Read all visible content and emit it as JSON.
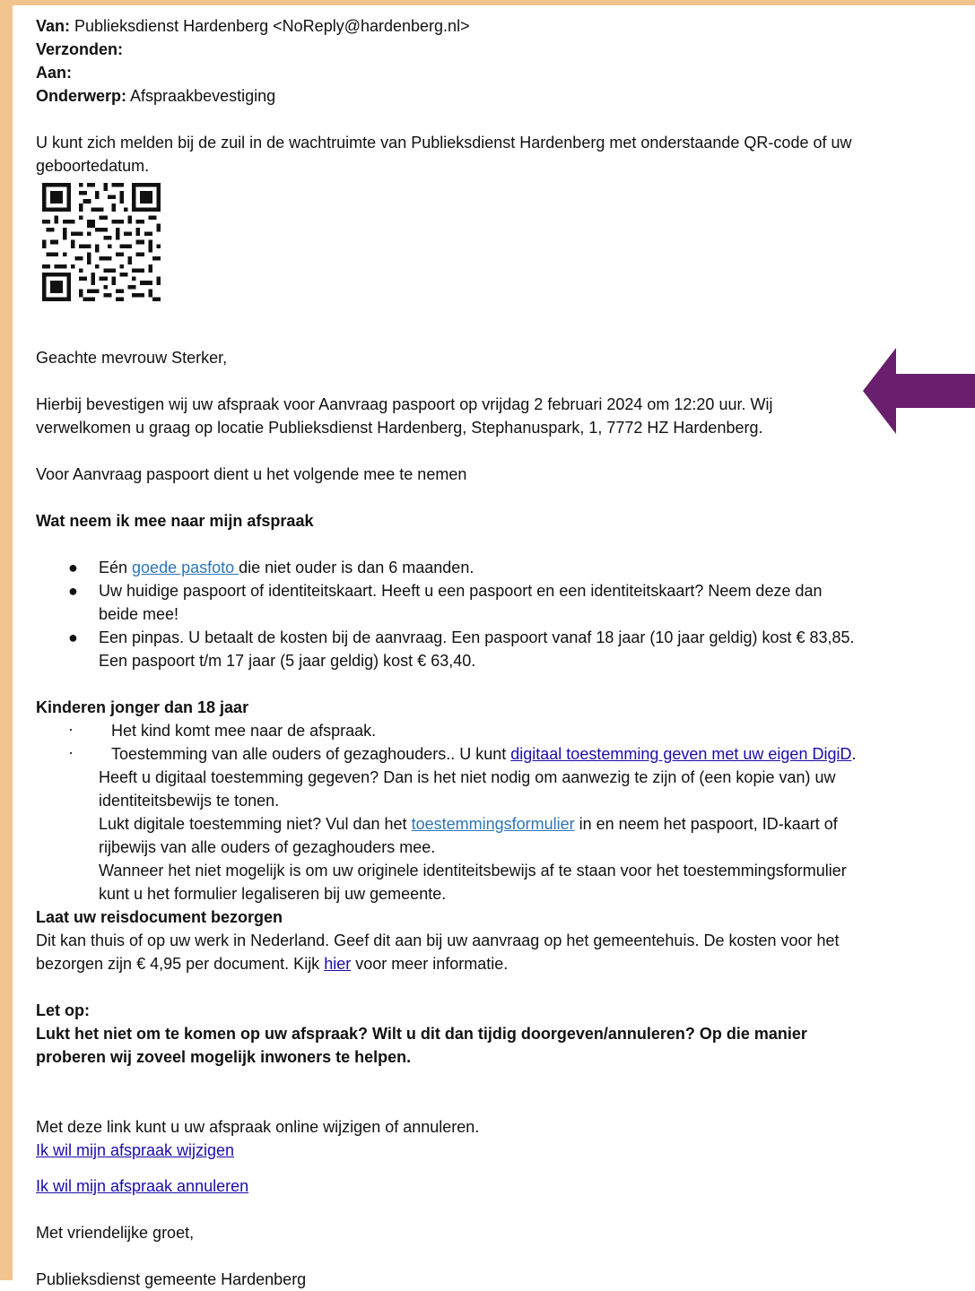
{
  "header": {
    "van_label": "Van:",
    "van_value": "Publieksdienst Hardenberg <NoReply@hardenberg.nl>",
    "verzonden_label": "Verzonden:",
    "aan_label": "Aan:",
    "onderwerp_label": "Onderwerp:",
    "onderwerp_value": "Afspraakbevestiging"
  },
  "intro": "U kunt zich melden bij de zuil in de wachtruimte van Publieksdienst Hardenberg met onderstaande QR-code of uw geboortedatum.",
  "greeting": "Geachte mevrouw Sterker,",
  "confirmation": "Hierbij bevestigen wij uw afspraak voor Aanvraag paspoort op vrijdag 2 februari 2024 om 12:20 uur. Wij verwelkomen u graag op locatie Publieksdienst Hardenberg, Stephanuspark, 1, 7772 HZ Hardenberg.",
  "bring_intro": "Voor Aanvraag paspoort dient u het volgende mee te nemen",
  "bring_heading": "Wat neem ik mee naar mijn afspraak",
  "bring_items": {
    "item1_pre": "Eén ",
    "item1_link": "goede pasfoto ",
    "item1_post": "die niet ouder is dan 6 maanden.",
    "item2": "Uw huidige paspoort of identiteitskaart. Heeft u een paspoort en een identiteitskaart? Neem deze dan beide mee!",
    "item3": "Een pinpas. U betaalt de kosten bij de aanvraag. Een paspoort vanaf 18 jaar (10 jaar geldig) kost € 83,85. Een paspoort t/m 17 jaar (5 jaar geldig) kost € 63,40."
  },
  "kids": {
    "heading": "Kinderen jonger dan 18 jaar",
    "item1": "Het kind komt mee naar de afspraak.",
    "item2_pre": "Toestemming van alle ouders of gezaghouders.. U kunt ",
    "item2_link": "digitaal toestemming geven met uw eigen DigiD",
    "item2_post": ". Heeft u digitaal toestemming gegeven? Dan is het niet nodig om aanwezig te zijn of (een kopie van) uw identiteitsbewijs te tonen.",
    "item2_line2_pre": "Lukt digitale toestemming niet? Vul dan het ",
    "item2_line2_link": "toestemmingsformulier",
    "item2_line2_post": " in en neem het paspoort, ID-kaart of rijbewijs van alle ouders of gezaghouders mee.",
    "item2_line3": "Wanneer het niet mogelijk is om uw originele identiteitsbewijs af te staan voor het toestemmingsformulier kunt u het formulier legaliseren bij uw gemeente."
  },
  "delivery": {
    "heading": "Laat uw reisdocument bezorgen",
    "text_pre": "Dit kan thuis of op uw werk in Nederland. Geef dit aan bij uw aanvraag op het gemeentehuis. De kosten voor het bezorgen zijn € 4,95 per document. Kijk ",
    "text_link": "hier",
    "text_post": " voor meer informatie."
  },
  "notice": {
    "heading": "Let op:",
    "text": "Lukt het niet om te komen op uw afspraak? Wilt u dit dan tijdig doorgeven/annuleren? Op die manier proberen wij zoveel mogelijk inwoners te helpen."
  },
  "links": {
    "intro": "Met deze link kunt u uw afspraak online wijzigen of annuleren.",
    "change": "Ik wil mijn afspraak wijzigen",
    "cancel": "Ik wil mijn afspraak annuleren"
  },
  "closing": "Met vriendelijke groet,",
  "signature": "Publieksdienst gemeente Hardenberg",
  "colors": {
    "border": "#f2c48d",
    "arrow": "#6a1f6e",
    "link": "#1a0dab",
    "link_alt": "#2e75b6"
  },
  "icons": {
    "qr": "qr-code-icon",
    "arrow": "arrow-left-icon",
    "bullet": "bullet-dot"
  }
}
